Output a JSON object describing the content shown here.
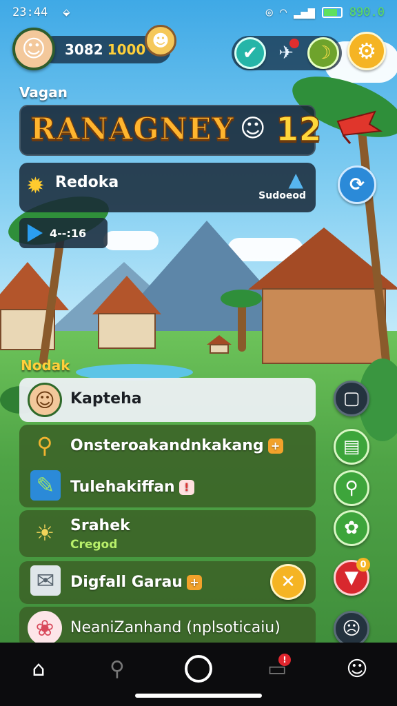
{
  "status_bar": {
    "time": "23:44",
    "battery_level": 0.8,
    "battery_text": "890.0"
  },
  "profile": {
    "currency_value": "3082",
    "currency_secondary": "1000"
  },
  "section_top_label": "Vagan",
  "level_banner": {
    "title": "RANAGNEY",
    "level": "12"
  },
  "info_card": {
    "label": "Redoka",
    "side_label": "Sudoeod"
  },
  "video_chip": {
    "label": "4--:16"
  },
  "section_list_label": "Nodak",
  "menu": [
    {
      "label": "Kapteha",
      "icon": "boy-avatar-icon"
    },
    {
      "label": "Onsteroakandnkakang",
      "icon": "torch-icon",
      "badge": "+"
    },
    {
      "label": "Tulehakiffan",
      "icon": "pencil-icon",
      "badge": "!"
    },
    {
      "label": "Srahek",
      "sub": "Cregod",
      "icon": "child-sun-icon"
    },
    {
      "label": "Digfall Garau",
      "icon": "document-icon",
      "badge": "+"
    },
    {
      "label": "NeaniZanhand (nplsoticaiu)",
      "icon": "rose-icon"
    }
  ],
  "side_actions_badge": "0",
  "notification_badge": "!",
  "colors": {
    "accent_orange": "#f5b424",
    "level_gold": "#ffb52e",
    "panel_dark": "#19283a",
    "panel_green": "#3c6428",
    "action_green": "#3da53b",
    "action_red": "#d8282e",
    "action_blue": "#2b8ad8"
  }
}
